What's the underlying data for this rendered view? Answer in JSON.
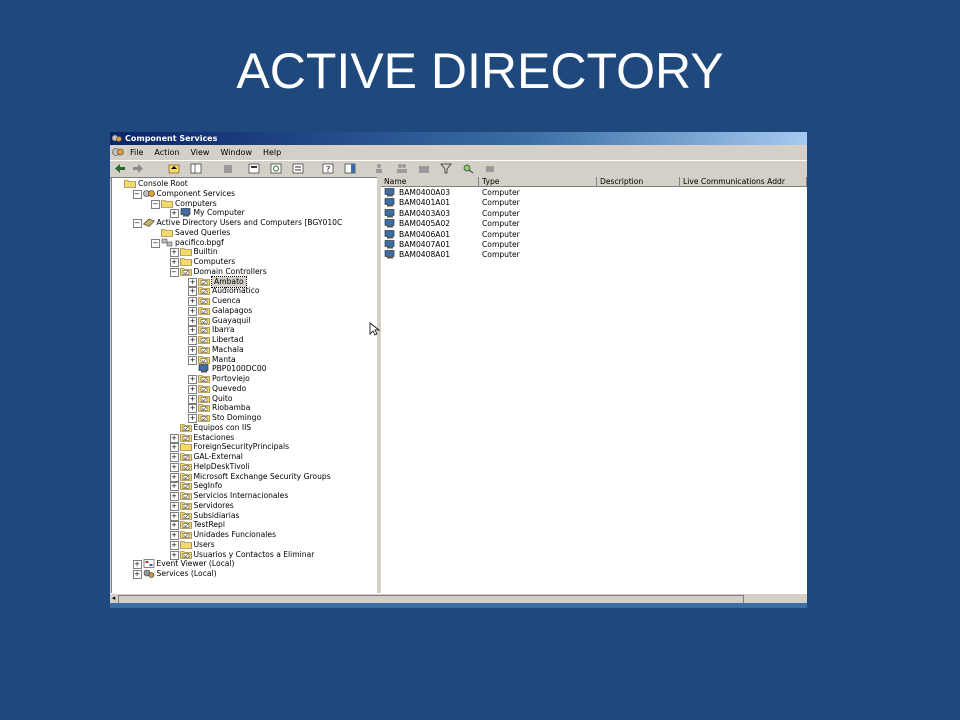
{
  "slide": {
    "title": "ACTIVE DIRECTORY"
  },
  "window": {
    "title": "Component Services",
    "menu": [
      "File",
      "Action",
      "View",
      "Window",
      "Help"
    ]
  },
  "tree": [
    {
      "label": "Console Root",
      "depth": 0,
      "expander": "",
      "icon": "folder-icon"
    },
    {
      "label": "Component Services",
      "depth": 1,
      "expander": "−",
      "icon": "component-services-icon"
    },
    {
      "label": "Computers",
      "depth": 2,
      "expander": "−",
      "icon": "folder-icon"
    },
    {
      "label": "My Computer",
      "depth": 3,
      "expander": "+",
      "icon": "computer-icon"
    },
    {
      "label": "Active Directory Users and Computers [BGY010C",
      "depth": 1,
      "expander": "−",
      "icon": "ad-users-icon"
    },
    {
      "label": "Saved Queries",
      "depth": 2,
      "expander": "",
      "icon": "folder-icon"
    },
    {
      "label": "pacifico.bpgf",
      "depth": 2,
      "expander": "−",
      "icon": "domain-icon"
    },
    {
      "label": "Builtin",
      "depth": 3,
      "expander": "+",
      "icon": "folder-icon"
    },
    {
      "label": "Computers",
      "depth": 3,
      "expander": "+",
      "icon": "folder-icon"
    },
    {
      "label": "Domain Controllers",
      "depth": 3,
      "expander": "−",
      "icon": "ou-icon"
    },
    {
      "label": "Ambato",
      "depth": 4,
      "expander": "+",
      "icon": "ou-icon",
      "selected": true
    },
    {
      "label": "Audiomatico",
      "depth": 4,
      "expander": "+",
      "icon": "ou-icon"
    },
    {
      "label": "Cuenca",
      "depth": 4,
      "expander": "+",
      "icon": "ou-icon"
    },
    {
      "label": "Galapagos",
      "depth": 4,
      "expander": "+",
      "icon": "ou-icon"
    },
    {
      "label": "Guayaquil",
      "depth": 4,
      "expander": "+",
      "icon": "ou-icon"
    },
    {
      "label": "Ibarra",
      "depth": 4,
      "expander": "+",
      "icon": "ou-icon"
    },
    {
      "label": "Libertad",
      "depth": 4,
      "expander": "+",
      "icon": "ou-icon"
    },
    {
      "label": "Machala",
      "depth": 4,
      "expander": "+",
      "icon": "ou-icon"
    },
    {
      "label": "Manta",
      "depth": 4,
      "expander": "+",
      "icon": "ou-icon"
    },
    {
      "label": "PBP0100DC00",
      "depth": 4,
      "expander": "",
      "icon": "computer-icon"
    },
    {
      "label": "Portoviejo",
      "depth": 4,
      "expander": "+",
      "icon": "ou-icon"
    },
    {
      "label": "Quevedo",
      "depth": 4,
      "expander": "+",
      "icon": "ou-icon"
    },
    {
      "label": "Quito",
      "depth": 4,
      "expander": "+",
      "icon": "ou-icon"
    },
    {
      "label": "Riobamba",
      "depth": 4,
      "expander": "+",
      "icon": "ou-icon"
    },
    {
      "label": "Sto Domingo",
      "depth": 4,
      "expander": "+",
      "icon": "ou-icon"
    },
    {
      "label": "Equipos con IIS",
      "depth": 3,
      "expander": "",
      "icon": "ou-icon"
    },
    {
      "label": "Estaciones",
      "depth": 3,
      "expander": "+",
      "icon": "ou-icon"
    },
    {
      "label": "ForeignSecurityPrincipals",
      "depth": 3,
      "expander": "+",
      "icon": "folder-icon"
    },
    {
      "label": "GAL-External",
      "depth": 3,
      "expander": "+",
      "icon": "ou-icon"
    },
    {
      "label": "HelpDeskTivoli",
      "depth": 3,
      "expander": "+",
      "icon": "ou-icon"
    },
    {
      "label": "Microsoft Exchange Security Groups",
      "depth": 3,
      "expander": "+",
      "icon": "ou-icon"
    },
    {
      "label": "SegInfo",
      "depth": 3,
      "expander": "+",
      "icon": "ou-icon"
    },
    {
      "label": "Servicios Internacionales",
      "depth": 3,
      "expander": "+",
      "icon": "ou-icon"
    },
    {
      "label": "Servidores",
      "depth": 3,
      "expander": "+",
      "icon": "ou-icon"
    },
    {
      "label": "Subsidiarias",
      "depth": 3,
      "expander": "+",
      "icon": "ou-icon"
    },
    {
      "label": "TestRepl",
      "depth": 3,
      "expander": "+",
      "icon": "ou-icon"
    },
    {
      "label": "Unidades Funcionales",
      "depth": 3,
      "expander": "+",
      "icon": "ou-icon"
    },
    {
      "label": "Users",
      "depth": 3,
      "expander": "+",
      "icon": "folder-icon"
    },
    {
      "label": "Usuarios y Contactos a Eliminar",
      "depth": 3,
      "expander": "+",
      "icon": "ou-icon"
    },
    {
      "label": "Event Viewer (Local)",
      "depth": 1,
      "expander": "+",
      "icon": "event-viewer-icon"
    },
    {
      "label": "Services (Local)",
      "depth": 1,
      "expander": "+",
      "icon": "services-icon"
    }
  ],
  "list": {
    "columns": [
      "Name",
      "Type",
      "Description",
      "Live Communications Addr"
    ],
    "rows": [
      {
        "name": "BAM0400A03",
        "type": "Computer"
      },
      {
        "name": "BAM0401A01",
        "type": "Computer"
      },
      {
        "name": "BAM0403A03",
        "type": "Computer"
      },
      {
        "name": "BAM0405A02",
        "type": "Computer"
      },
      {
        "name": "BAM0406A01",
        "type": "Computer"
      },
      {
        "name": "BAM0407A01",
        "type": "Computer"
      },
      {
        "name": "BAM0408A01",
        "type": "Computer"
      }
    ]
  },
  "colors": {
    "slide_bg": "#1f497d",
    "titlebar": "#0a246a",
    "window_bg": "#d4d0c8",
    "folder": "#f4d96b"
  }
}
